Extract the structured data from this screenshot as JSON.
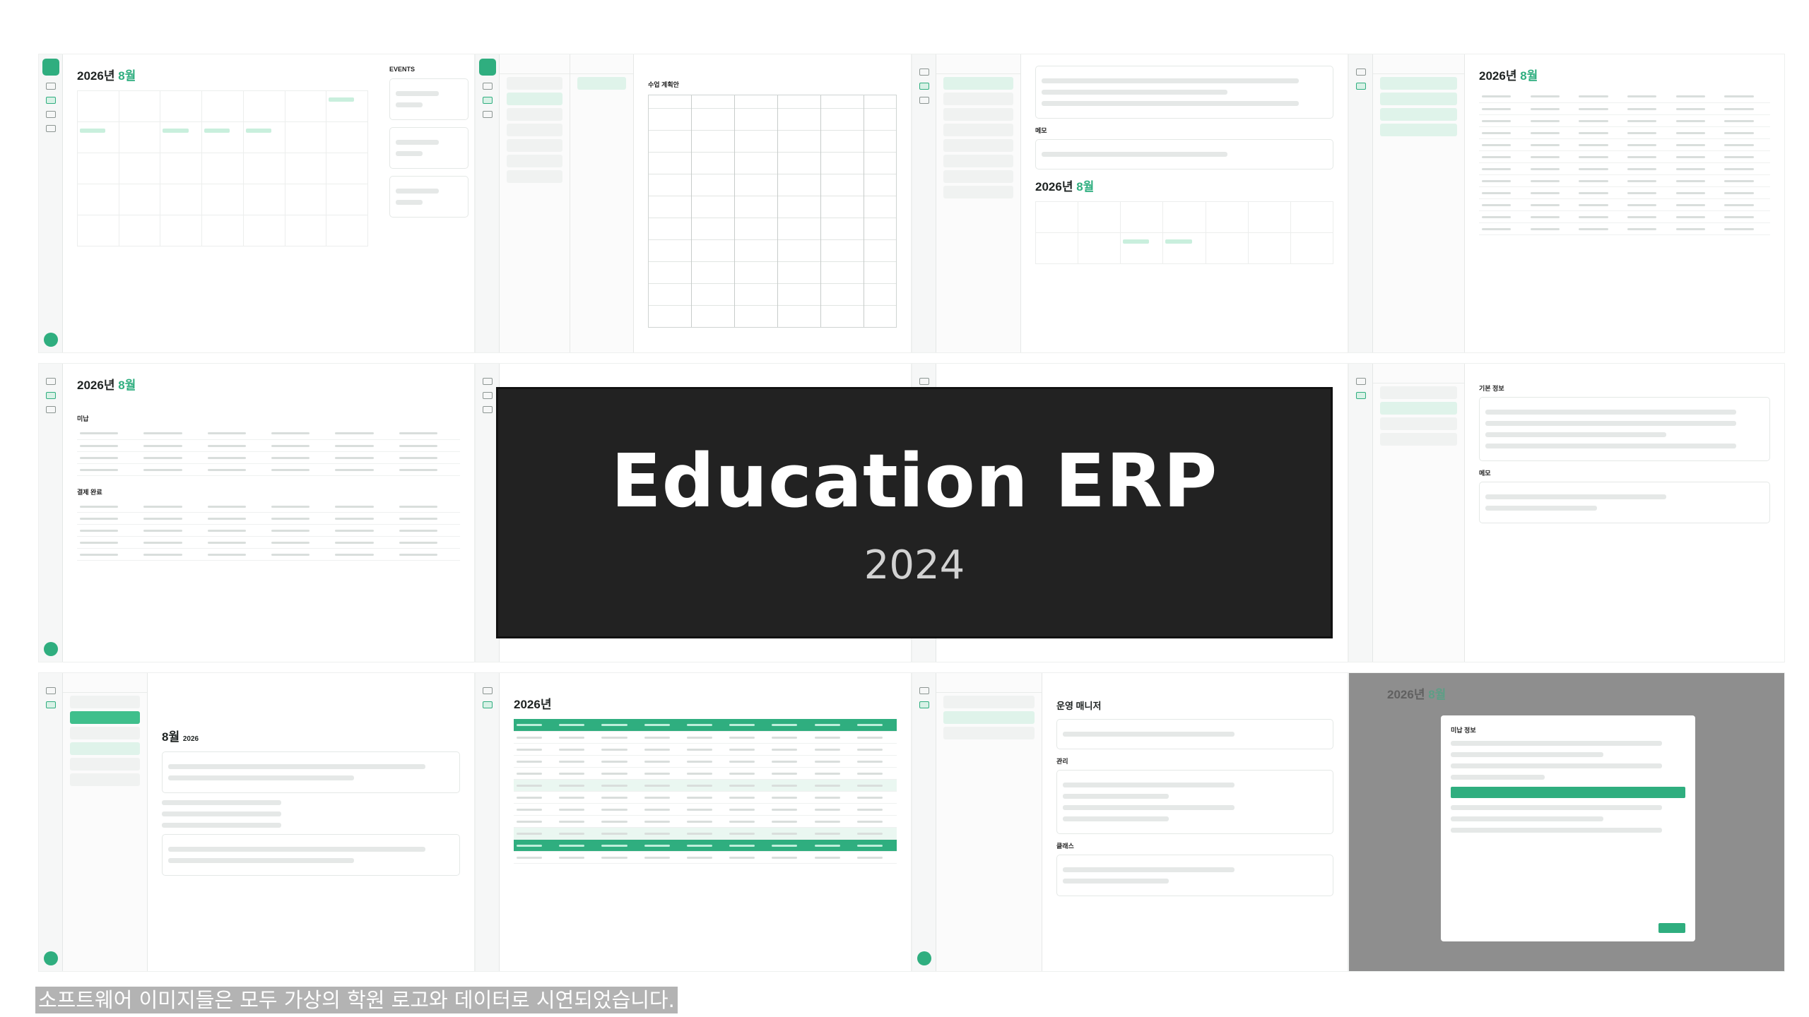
{
  "hero": {
    "title": "Education ERP",
    "year": "2024"
  },
  "caption": "소프트웨어 이미지들은 모두 가상의 학원 로고와 데이터로 시연되었습니다.",
  "brand_color": "#2fae7f",
  "screens": [
    {
      "id": "calendar-month",
      "title_prefix": "2026년 ",
      "title_accent": "8월",
      "side_label": "EVENTS"
    },
    {
      "id": "lesson-plan",
      "title": "수업 계획안"
    },
    {
      "id": "student-detail",
      "title_prefix": "2026년 ",
      "title_accent": "8월",
      "memo_label": "메모"
    },
    {
      "id": "weekly-schedule",
      "title_prefix": "2026년 ",
      "title_accent": "8월"
    },
    {
      "id": "billing",
      "title_prefix": "2026년 ",
      "title_accent": "8월",
      "section_a": "미납",
      "section_b": "결제 완료"
    },
    {
      "id": "basic-info",
      "title": "기본 정보",
      "memo_label": "메모"
    },
    {
      "id": "attendance-list",
      "title_prefix": "8월 ",
      "title_suffix": "2026"
    },
    {
      "id": "yearly-stats",
      "title": "2026년"
    },
    {
      "id": "org-manager",
      "title": "운영 매니저",
      "section_a": "관리",
      "section_b": "클래스"
    },
    {
      "id": "billing-modal",
      "title_prefix": "2026년 ",
      "title_accent": "8월",
      "modal_title": "미납 정보"
    }
  ]
}
